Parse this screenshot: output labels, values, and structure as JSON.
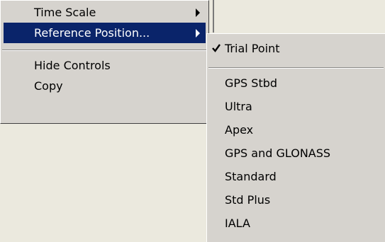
{
  "main_menu": {
    "items": [
      {
        "label": "Time Scale",
        "has_submenu": true
      },
      {
        "label": "Reference Position...",
        "has_submenu": true,
        "highlighted": true
      },
      {
        "label": "Hide Controls"
      },
      {
        "label": "Copy"
      }
    ]
  },
  "submenu": {
    "items": [
      {
        "label": "Trial Point",
        "checked": true
      },
      {
        "label": "GPS Stbd"
      },
      {
        "label": "Ultra"
      },
      {
        "label": "Apex"
      },
      {
        "label": "GPS and GLONASS"
      },
      {
        "label": "Standard"
      },
      {
        "label": "Std Plus"
      },
      {
        "label": "IALA"
      }
    ]
  },
  "colors": {
    "menu_bg": "#d6d3ce",
    "highlight_bg": "#0a246a",
    "highlight_text": "#ffffff",
    "desktop_bg": "#ebe9de"
  },
  "icons": {
    "submenu_arrow": "triangle-right",
    "checked": "checkmark"
  }
}
